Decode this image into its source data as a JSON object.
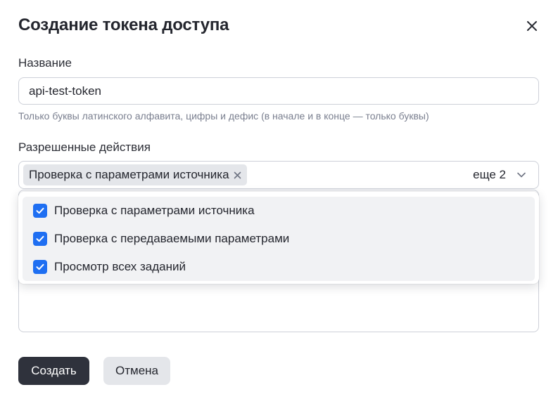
{
  "dialog": {
    "title": "Создание токена доступа",
    "close_icon": "close-icon"
  },
  "name_field": {
    "label": "Название",
    "value": "api-test-token",
    "hint": "Только буквы латинского алфавита, цифры и дефис (в начале и в конце — только буквы)"
  },
  "permissions": {
    "label": "Разрешенные действия",
    "selected_chip": "Проверка с параметрами источника",
    "more_label": "еще 2",
    "options": [
      {
        "label": "Проверка с параметрами источника",
        "checked": true
      },
      {
        "label": "Проверка с передаваемыми параметрами",
        "checked": true
      },
      {
        "label": "Просмотр всех заданий",
        "checked": true
      }
    ]
  },
  "buttons": {
    "create": "Создать",
    "cancel": "Отмена"
  },
  "colors": {
    "primary_button": "#2f323c",
    "checkbox": "#1f6ff2",
    "chip_bg": "#e4e6ea"
  }
}
